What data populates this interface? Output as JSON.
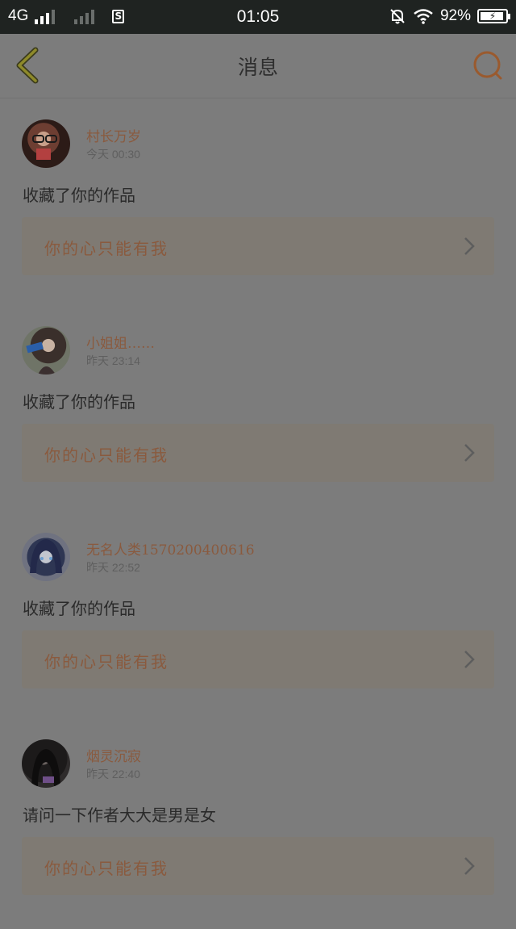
{
  "status_bar": {
    "network": "4G",
    "time": "01:05",
    "battery": "92%"
  },
  "nav": {
    "title": "消息"
  },
  "colors": {
    "accent": "#c0733a",
    "back_icon": "#8e8a2a"
  },
  "messages": [
    {
      "username": "村长万岁",
      "time": "今天 00:30",
      "text": "收藏了你的作品",
      "work_title": "你的心只能有我",
      "avatar": "avatar-woman-glasses"
    },
    {
      "username": "小姐姐……",
      "time": "昨天 23:14",
      "text": "收藏了你的作品",
      "work_title": "你的心只能有我",
      "avatar": "avatar-woman-phone"
    },
    {
      "username": "无名人类1570200400616",
      "time": "昨天 22:52",
      "text": "收藏了你的作品",
      "work_title": "你的心只能有我",
      "avatar": "avatar-anime-girl"
    },
    {
      "username": "烟灵沉寂",
      "time": "昨天 22:40",
      "text": "请问一下作者大大是男是女",
      "work_title": "你的心只能有我",
      "avatar": "avatar-dark-anime"
    }
  ]
}
